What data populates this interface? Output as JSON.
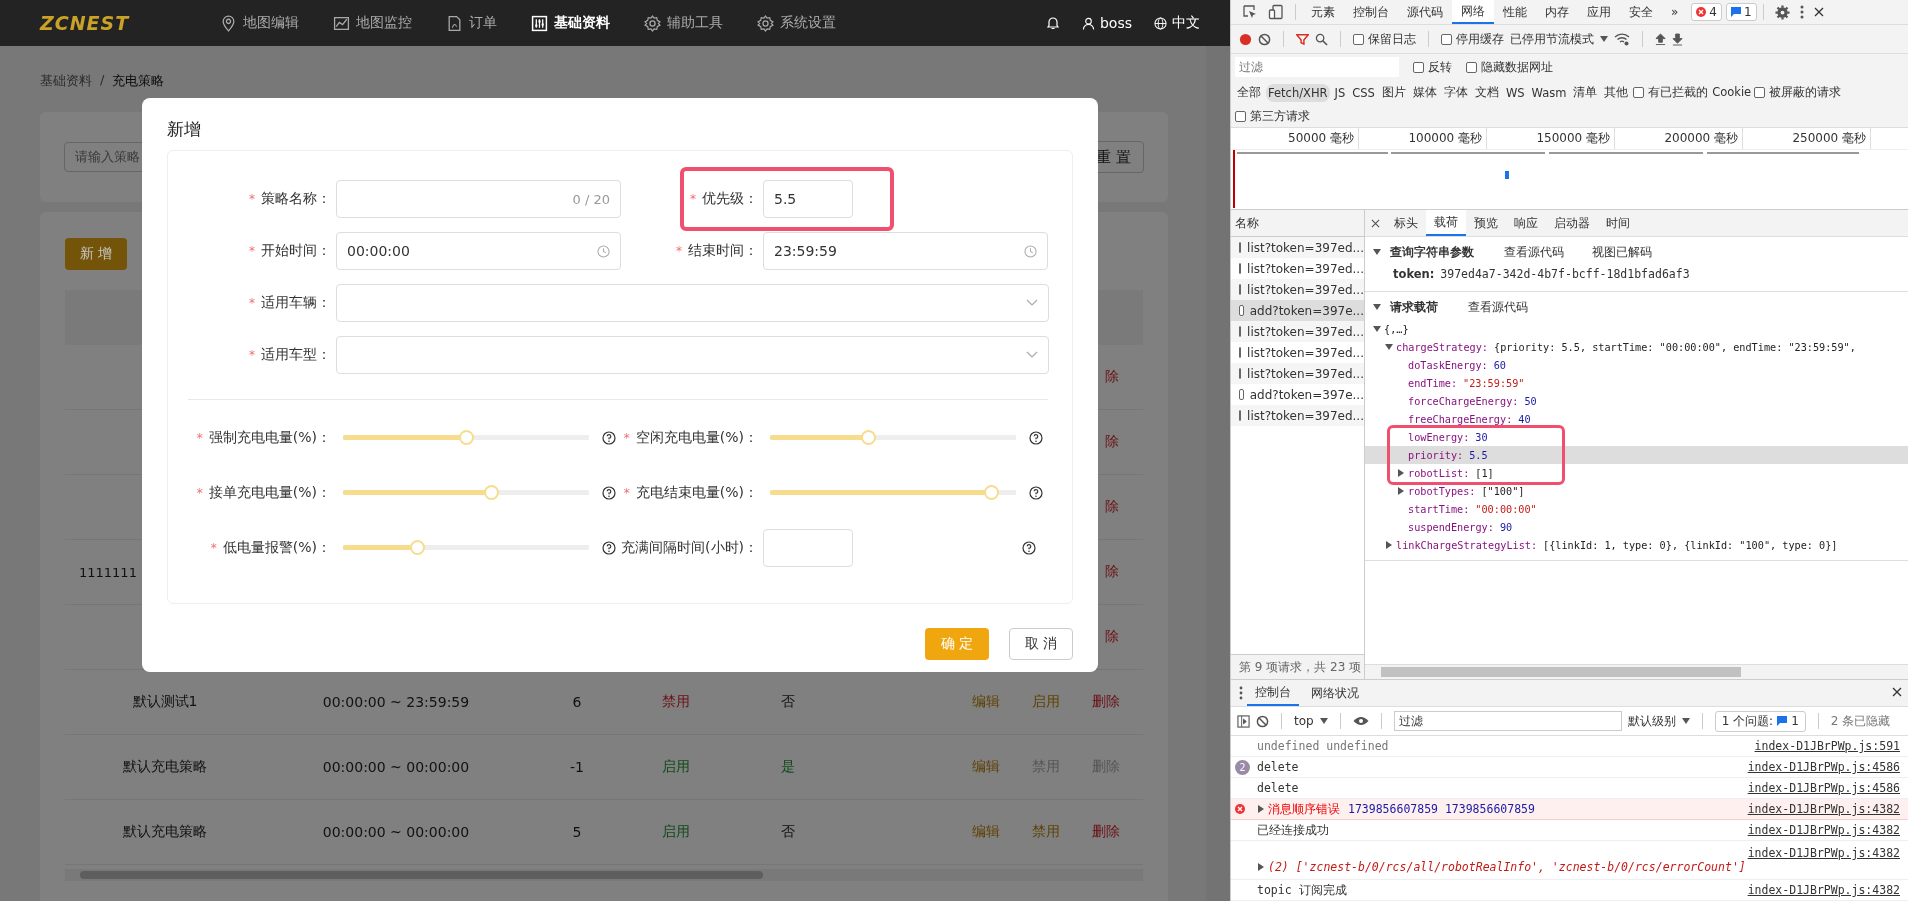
{
  "app": {
    "logo": "ZCNEST",
    "nav": [
      {
        "label": "地图编辑",
        "selected": false
      },
      {
        "label": "地图监控",
        "selected": false
      },
      {
        "label": "订单",
        "selected": false
      },
      {
        "label": "基础资料",
        "selected": true
      },
      {
        "label": "辅助工具",
        "selected": false
      },
      {
        "label": "系统设置",
        "selected": false
      }
    ],
    "user": "boss",
    "language": "中文",
    "breadcrumb": [
      {
        "label": "基础资料",
        "current": false
      },
      {
        "label": "充电策略",
        "current": true
      }
    ],
    "breadcrumb_separator": "/",
    "search": {
      "placeholder": "请输入策略",
      "reset": "重 置"
    },
    "add_button": "新 增",
    "table": {
      "rows": [
        {
          "kind": "covered",
          "delete": "除"
        },
        {
          "kind": "covered",
          "delete": "除"
        },
        {
          "kind": "covered",
          "delete": "除"
        },
        {
          "kind": "covered",
          "name": "1111111",
          "delete": "除"
        },
        {
          "kind": "covered",
          "delete": "除"
        },
        {
          "kind": "full",
          "name": "默认测试1",
          "time": "00:00:00 ~ 23:59:59",
          "priority": "6",
          "status": "禁用",
          "enabled": false,
          "is_default": "否",
          "default": false,
          "actions": [
            {
              "label": "编辑",
              "disabled": false,
              "kind": "edit"
            },
            {
              "label": "启用",
              "disabled": false,
              "kind": "toggle"
            },
            {
              "label": "删除",
              "disabled": false,
              "kind": "delete"
            }
          ]
        },
        {
          "kind": "full",
          "name": "默认充电策略",
          "time": "00:00:00 ~ 00:00:00",
          "priority": "-1",
          "status": "启用",
          "enabled": true,
          "is_default": "是",
          "default": true,
          "actions": [
            {
              "label": "编辑",
              "disabled": false,
              "kind": "edit"
            },
            {
              "label": "禁用",
              "disabled": true,
              "kind": "toggle"
            },
            {
              "label": "删除",
              "disabled": true,
              "kind": "delete"
            }
          ]
        },
        {
          "kind": "full",
          "name": "默认充电策略",
          "time": "00:00:00 ~ 00:00:00",
          "priority": "5",
          "status": "启用",
          "enabled": true,
          "is_default": "否",
          "default": false,
          "actions": [
            {
              "label": "编辑",
              "disabled": false,
              "kind": "edit"
            },
            {
              "label": "禁用",
              "disabled": false,
              "kind": "toggle"
            },
            {
              "label": "删除",
              "disabled": false,
              "kind": "delete"
            }
          ]
        }
      ]
    },
    "modal": {
      "title": "新增",
      "form_rows": [
        {
          "fields": [
            {
              "kind": "text",
              "mark": "*",
              "label": "策略名称：",
              "counter": "0 / 20"
            },
            {
              "kind": "short",
              "mark": "*",
              "label": "优先级：",
              "value": "5.5",
              "annotated": true
            }
          ]
        },
        {
          "fields": [
            {
              "kind": "time",
              "mark": "*",
              "label": "开始时间：",
              "value": "00:00:00"
            },
            {
              "kind": "time",
              "mark": "*",
              "label": "结束时间：",
              "value": "23:59:59"
            }
          ]
        },
        {
          "fields": [
            {
              "kind": "select",
              "mark": "*",
              "label": "适用车辆："
            }
          ]
        },
        {
          "fields": [
            {
              "kind": "select",
              "mark": "*",
              "label": "适用车型："
            }
          ]
        }
      ],
      "slider_rows": [
        {
          "fields": [
            {
              "kind": "slider",
              "mark": "*",
              "label": "强制充电电量(%)：",
              "level": 0.5
            },
            {
              "kind": "slider",
              "mark": "*",
              "label": "空闲充电电量(%)：",
              "level": 0.4
            }
          ]
        },
        {
          "fields": [
            {
              "kind": "slider",
              "mark": "*",
              "label": "接单充电电量(%)：",
              "level": 0.6
            },
            {
              "kind": "slider",
              "mark": "*",
              "label": "充电结束电量(%)：",
              "level": 0.9
            }
          ]
        },
        {
          "fields": [
            {
              "kind": "slider",
              "mark": "*",
              "label": "低电量报警(%)：",
              "level": 0.3
            },
            {
              "kind": "number",
              "label": "充满间隔时间(小时)："
            }
          ]
        }
      ],
      "confirm": "确 定",
      "cancel": "取 消"
    }
  },
  "devtools": {
    "tabs": [
      {
        "label": "元素",
        "selected": false
      },
      {
        "label": "控制台",
        "selected": false
      },
      {
        "label": "源代码",
        "selected": false
      },
      {
        "label": "网络",
        "selected": true
      },
      {
        "label": "性能",
        "selected": false
      },
      {
        "label": "内存",
        "selected": false
      },
      {
        "label": "应用",
        "selected": false
      },
      {
        "label": "安全",
        "selected": false
      }
    ],
    "more": "»",
    "error_count": "4",
    "message_count": "1",
    "preserve_log": {
      "label": "保留日志",
      "checked": false
    },
    "disable_cache": {
      "label": "停用缓存",
      "checked": false
    },
    "throttle": "已停用节流模式",
    "filter_placeholder": "过滤",
    "invert": {
      "label": "反转",
      "checked": false
    },
    "hide_data_urls": {
      "label": "隐藏数据网址",
      "checked": false
    },
    "types": [
      {
        "label": "全部",
        "selected": false
      },
      {
        "label": "Fetch/XHR",
        "selected": true
      },
      {
        "label": "JS",
        "selected": false
      },
      {
        "label": "CSS",
        "selected": false
      },
      {
        "label": "图片",
        "selected": false
      },
      {
        "label": "媒体",
        "selected": false
      },
      {
        "label": "字体",
        "selected": false
      },
      {
        "label": "文档",
        "selected": false
      },
      {
        "label": "WS",
        "selected": false
      },
      {
        "label": "Wasm",
        "selected": false
      },
      {
        "label": "清单",
        "selected": false
      },
      {
        "label": "其他",
        "selected": false
      }
    ],
    "blocked_cookies": {
      "label": "有已拦截的 Cookie",
      "checked": false
    },
    "blocked_requests": {
      "label": "被屏蔽的请求",
      "checked": false
    },
    "third_party": {
      "label": "第三方请求",
      "checked": false
    },
    "timeline_ticks": [
      "50000 毫秒",
      "100000 毫秒",
      "150000 毫秒",
      "200000 毫秒",
      "250000 毫秒"
    ],
    "name_header": "名称",
    "requests": [
      {
        "name": "list?token=397ed...",
        "selected": false
      },
      {
        "name": "list?token=397ed...",
        "selected": false
      },
      {
        "name": "list?token=397ed...",
        "selected": false
      },
      {
        "name": "add?token=397e...",
        "selected": true
      },
      {
        "name": "list?token=397ed...",
        "selected": false
      },
      {
        "name": "list?token=397ed...",
        "selected": false
      },
      {
        "name": "list?token=397ed...",
        "selected": false
      },
      {
        "name": "add?token=397e...",
        "selected": false
      },
      {
        "name": "list?token=397ed...",
        "selected": false
      }
    ],
    "summary": "第 9 项请求，共 23 项",
    "detail_tabs": [
      {
        "label": "标头",
        "selected": false
      },
      {
        "label": "载荷",
        "selected": true
      },
      {
        "label": "预览",
        "selected": false
      },
      {
        "label": "响应",
        "selected": false
      },
      {
        "label": "启动器",
        "selected": false
      },
      {
        "label": "时间",
        "selected": false
      }
    ],
    "query_section": {
      "title": "查询字符串参数",
      "links": [
        "查看源代码",
        "视图已解码"
      ],
      "params": [
        {
          "key": "token:",
          "value": "397ed4a7-342d-4b7f-bcff-18d1bfad6af3"
        }
      ]
    },
    "payload_section": {
      "title": "请求载荷",
      "links": [
        "查看源代码"
      ],
      "tree": [
        {
          "preview": "{,…}",
          "expanded": true,
          "highlighted": false,
          "children": [
            {
              "key": "chargeStrategy:",
              "preview": "{priority: 5.5, startTime: \"00:00:00\", endTime: \"23:59:59\",",
              "expanded": true,
              "highlighted": false,
              "children": [
                {
                  "key": "doTaskEnergy:",
                  "value": "60",
                  "kind": "number",
                  "highlighted": false
                },
                {
                  "key": "endTime:",
                  "value": "\"23:59:59\"",
                  "kind": "string",
                  "highlighted": false
                },
                {
                  "key": "forceChargeEnergy:",
                  "value": "50",
                  "kind": "number",
                  "highlighted": false
                },
                {
                  "key": "freeChargeEnergy:",
                  "value": "40",
                  "kind": "number",
                  "highlighted": false
                },
                {
                  "key": "lowEnergy:",
                  "value": "30",
                  "kind": "number",
                  "highlighted": false,
                  "annotated": true
                },
                {
                  "key": "priority:",
                  "value": "5.5",
                  "kind": "number",
                  "highlighted": true,
                  "annotated": true
                },
                {
                  "key": "robotList:",
                  "value": "[1]",
                  "kind": "array",
                  "expanded": false,
                  "highlighted": false,
                  "annotated": true
                },
                {
                  "key": "robotTypes:",
                  "value": "[\"100\"]",
                  "kind": "array",
                  "expanded": false,
                  "highlighted": false
                },
                {
                  "key": "startTime:",
                  "value": "\"00:00:00\"",
                  "kind": "string",
                  "highlighted": false
                },
                {
                  "key": "suspendEnergy:",
                  "value": "90",
                  "kind": "number",
                  "highlighted": false
                }
              ]
            },
            {
              "key": "linkChargeStrategyList:",
              "value": "[{linkId: 1, type: 0}, {linkId: \"100\", type: 0}]",
              "kind": "array",
              "expanded": false,
              "highlighted": false
            }
          ]
        }
      ]
    }
  },
  "console": {
    "tabs": [
      {
        "label": "控制台",
        "selected": true
      },
      {
        "label": "网络状况",
        "selected": false
      }
    ],
    "context": "top",
    "filter_placeholder": "过滤",
    "level": "默认级别",
    "issues_label": "1 个问题:",
    "issues_count": "1",
    "hidden": "2 条已隐藏",
    "messages": [
      {
        "kind": "muted",
        "text": "undefined undefined",
        "source": "index-D1JBrPWp.js:591"
      },
      {
        "kind": "log",
        "count": "2",
        "text": "delete",
        "source": "index-D1JBrPWp.js:4586"
      },
      {
        "kind": "log",
        "text": "delete",
        "source": "index-D1JBrPWp.js:4586"
      },
      {
        "kind": "error",
        "text": "消息顺序错误",
        "args": "1739856607859 1739856607859",
        "source": "index-D1JBrPWp.js:4382"
      },
      {
        "kind": "log",
        "text": "已经连接成功",
        "source": "index-D1JBrPWp.js:4382"
      },
      {
        "kind": "array",
        "text": "(2) ['zcnest-b/0/rcs/all/robotRealInfo', 'zcnest-b/0/rcs/errorCount']",
        "source": "index-D1JBrPWp.js:4382"
      },
      {
        "kind": "log",
        "text": "topic 订阅完成",
        "source": "index-D1JBrPWp.js:4382"
      }
    ]
  }
}
